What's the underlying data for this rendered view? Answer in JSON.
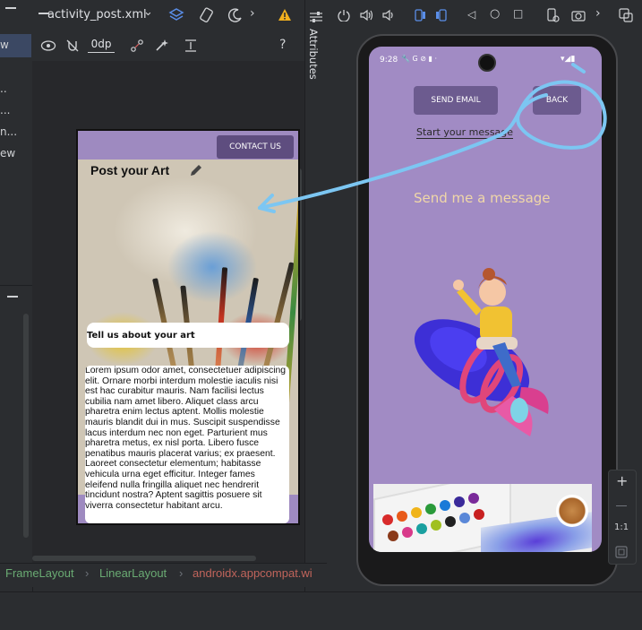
{
  "left_panel": {
    "items": [
      "w",
      "..",
      "...",
      "n...",
      "ew"
    ]
  },
  "editor": {
    "file_tab": "activity_post.xml",
    "dp_value": "0dp",
    "attributes_label": "Attributes"
  },
  "preview": {
    "contact_button": "CONTACT US",
    "title": "Post your Art",
    "tell_us_label": "Tell us about your art",
    "lorem": "Lorem ipsum odor amet, consectetuer adipiscing elit. Ornare morbi interdum molestie iaculis nisi est hac curabitur mauris. Nam facilisi lectus cubilia nam amet libero. Aliquet class arcu pharetra enim lectus aptent. Mollis molestie mauris blandit dui in mus. Suscipit suspendisse lacus interdum nec non eget. Parturient mus pharetra metus, ex nisl porta. Libero fusce penatibus mauris placerat varius; ex praesent. Laoreet consectetur elementum; habitasse vehicula urna eget efficitur. Integer fames eleifend nulla fringilla aliquet nec hendrerit tincidunt nostra? Aptent sagittis posuere sit viverra consectetur habitant arcu."
  },
  "phone": {
    "status_time": "9:28",
    "send_email_button": "SEND EMAIL",
    "back_button": "BACK",
    "start_message": "Start your message",
    "send_message": "Send me a message"
  },
  "zoom_tools": {
    "ratio": "1:1"
  },
  "breadcrumbs": [
    "FrameLayout",
    "LinearLayout",
    "androidx.appcompat.wi"
  ],
  "colors": {
    "ide_bg": "#2b2d30",
    "preview_purple": "#9e8ac0",
    "phone_purple": "#a18bc4",
    "button_purple": "#6c5b8f",
    "annotation_blue": "#7cc6f2",
    "crumb_green": "#6aab73",
    "crumb_red": "#c0645b",
    "warning": "#f2b01e"
  }
}
